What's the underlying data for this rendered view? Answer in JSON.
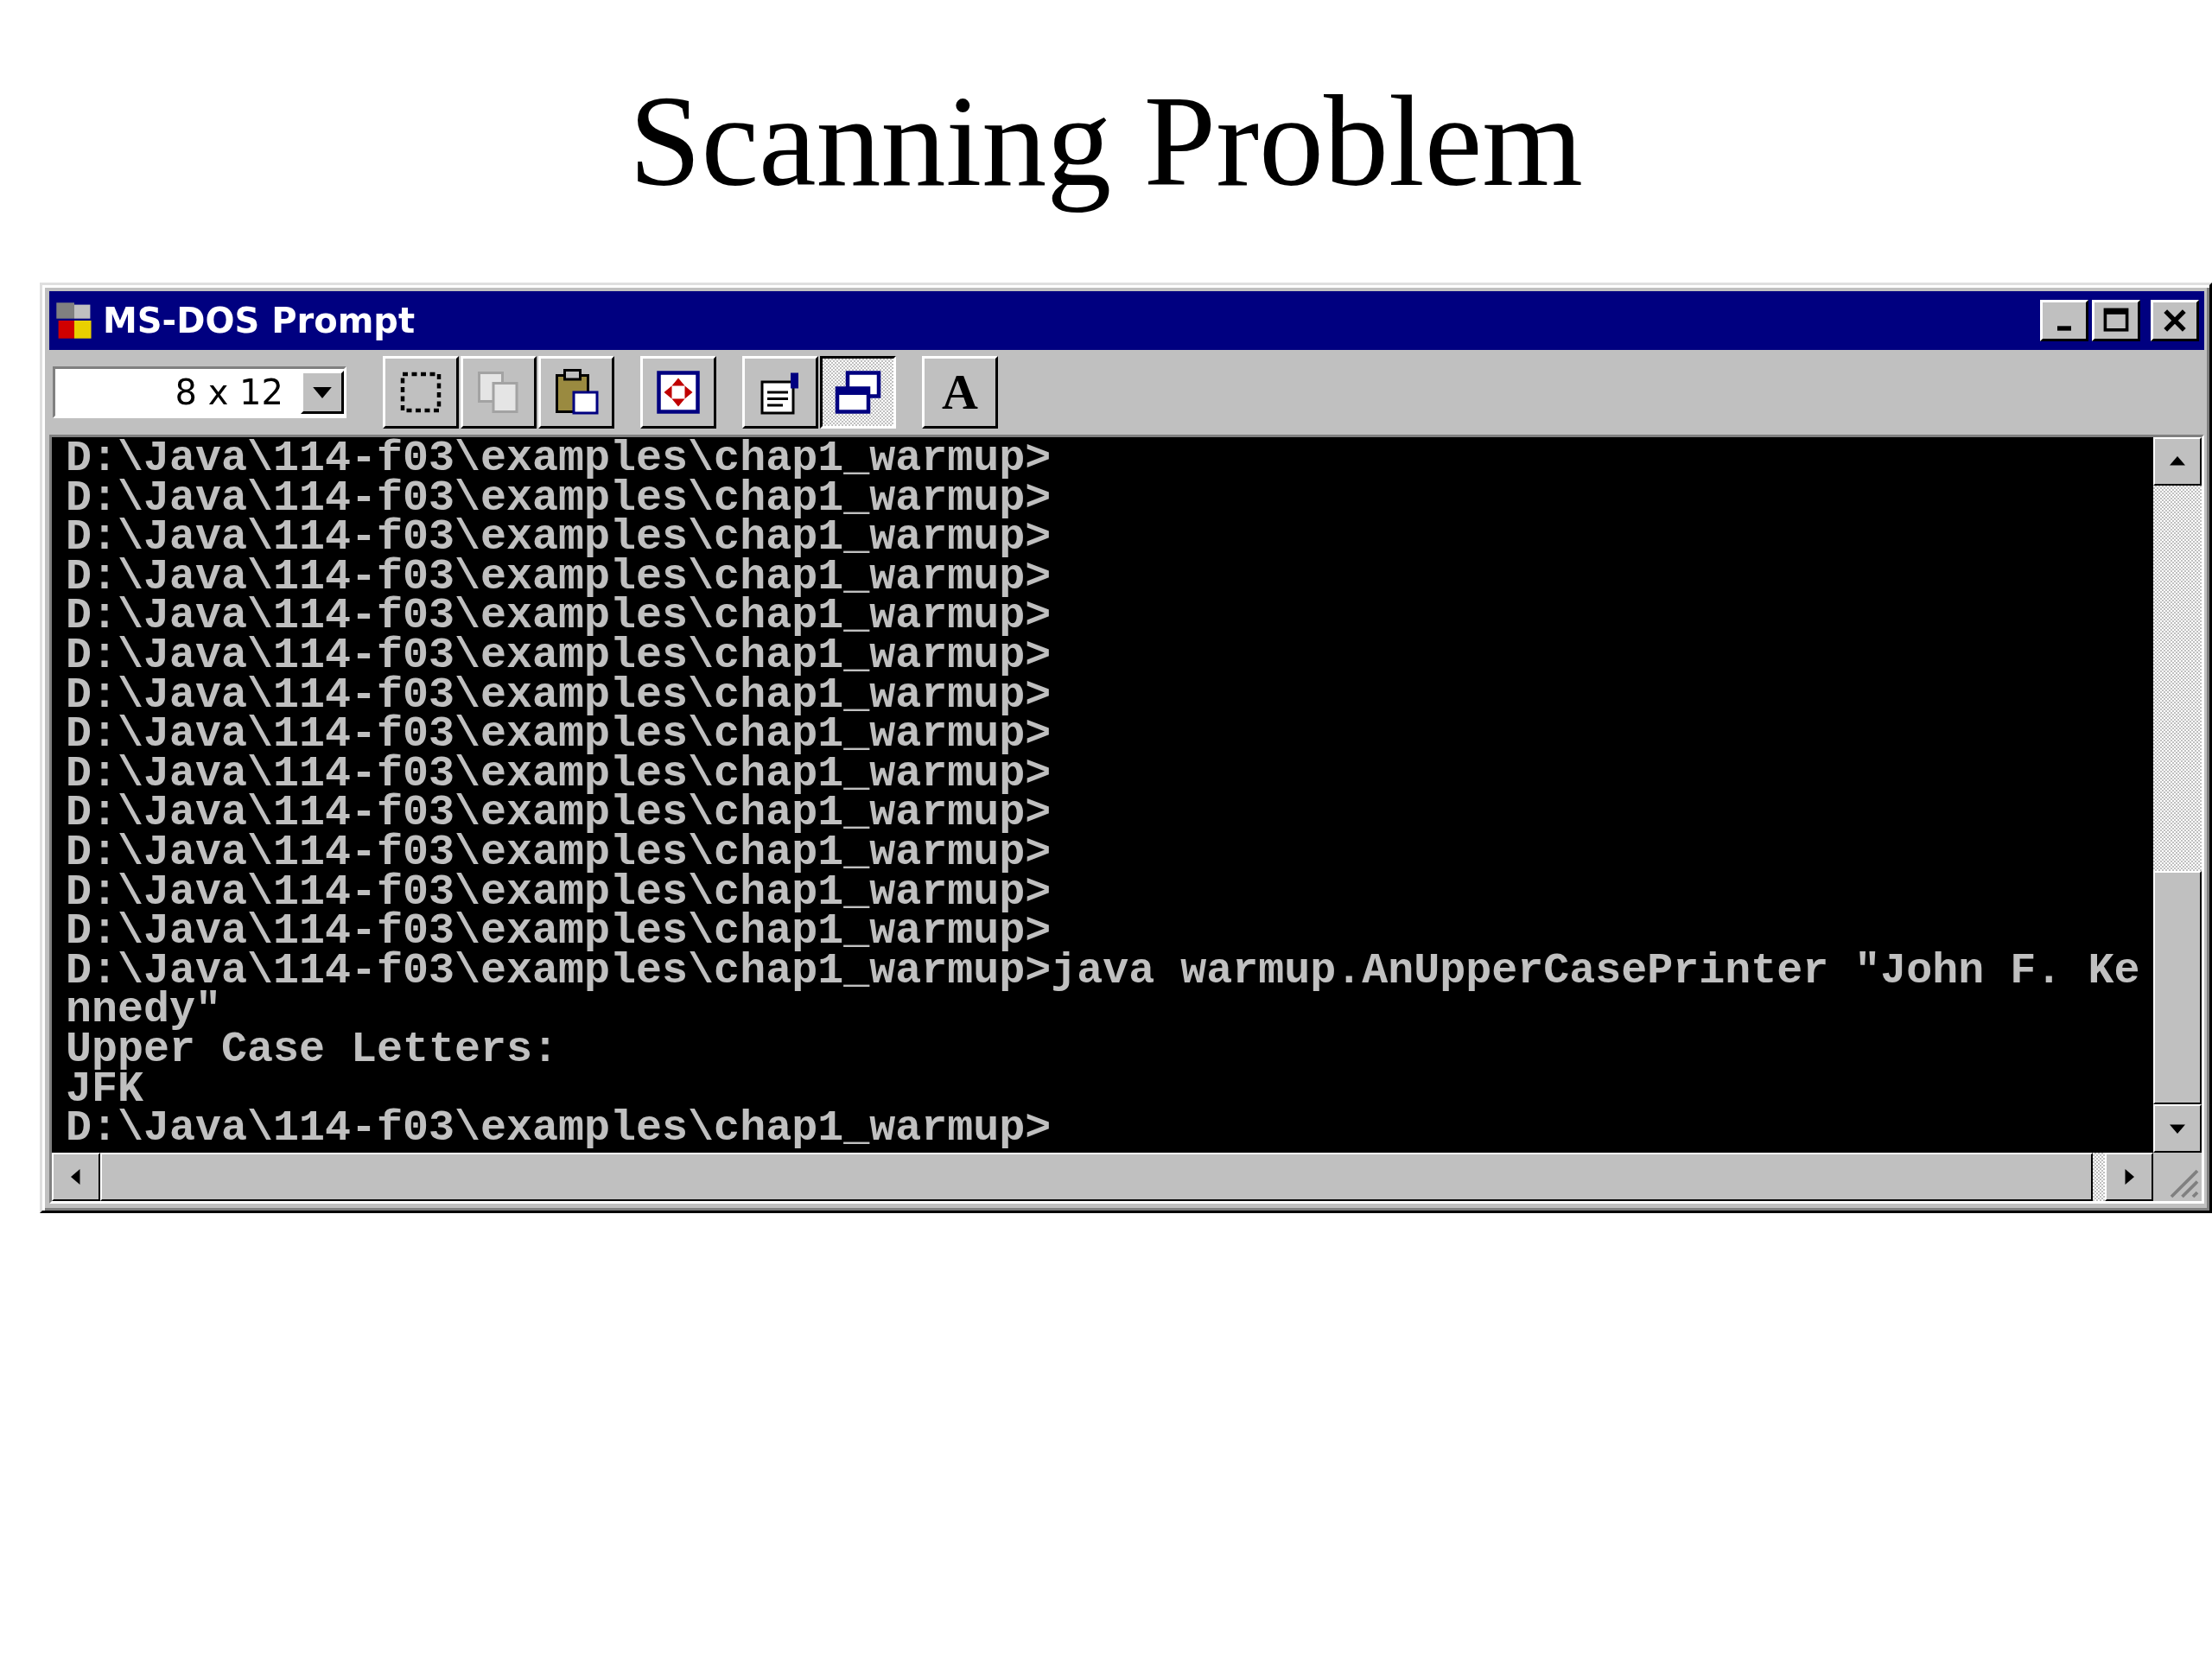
{
  "slide_title": "Scanning Problem",
  "window": {
    "title": "MS-DOS Prompt"
  },
  "toolbar": {
    "font_size": "8 x 12",
    "buttons": [
      {
        "kind": "mark",
        "pressed": false,
        "disabled": false
      },
      {
        "kind": "copy",
        "pressed": false,
        "disabled": true
      },
      {
        "kind": "paste",
        "pressed": false,
        "disabled": false
      },
      {
        "kind": "fullscreen",
        "pressed": false,
        "disabled": false
      },
      {
        "kind": "properties",
        "pressed": false,
        "disabled": false
      },
      {
        "kind": "background",
        "pressed": true,
        "disabled": false
      },
      {
        "kind": "font",
        "pressed": false,
        "disabled": false,
        "label": "A"
      }
    ]
  },
  "console_lines": [
    "D:\\Java\\114-f03\\examples\\chap1_warmup>",
    "D:\\Java\\114-f03\\examples\\chap1_warmup>",
    "D:\\Java\\114-f03\\examples\\chap1_warmup>",
    "D:\\Java\\114-f03\\examples\\chap1_warmup>",
    "D:\\Java\\114-f03\\examples\\chap1_warmup>",
    "D:\\Java\\114-f03\\examples\\chap1_warmup>",
    "D:\\Java\\114-f03\\examples\\chap1_warmup>",
    "D:\\Java\\114-f03\\examples\\chap1_warmup>",
    "D:\\Java\\114-f03\\examples\\chap1_warmup>",
    "D:\\Java\\114-f03\\examples\\chap1_warmup>",
    "D:\\Java\\114-f03\\examples\\chap1_warmup>",
    "D:\\Java\\114-f03\\examples\\chap1_warmup>",
    "D:\\Java\\114-f03\\examples\\chap1_warmup>",
    "D:\\Java\\114-f03\\examples\\chap1_warmup>java warmup.AnUpperCasePrinter \"John F. Ke",
    "nnedy\"",
    "Upper Case Letters:",
    "JFK",
    "D:\\Java\\114-f03\\examples\\chap1_warmup>"
  ]
}
